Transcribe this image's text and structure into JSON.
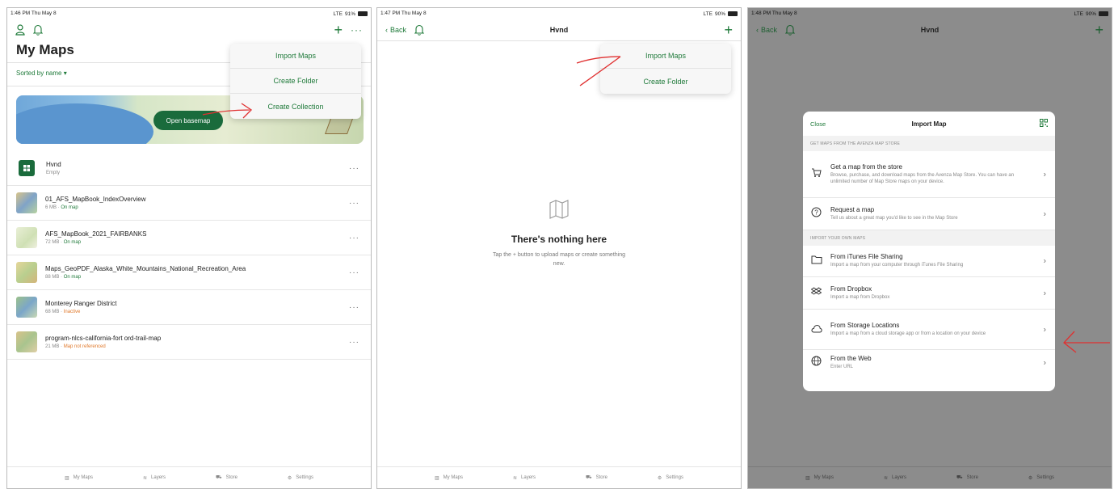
{
  "screen1": {
    "status": {
      "time": "1:46 PM  Thu May 8",
      "signal": "LTE",
      "battery": "91%"
    },
    "title": "My Maps",
    "sort_label": "Sorted by name",
    "basemap_button": "Open basemap",
    "menu": [
      "Import Maps",
      "Create Folder",
      "Create Collection"
    ],
    "items": [
      {
        "name": "Hvnd",
        "size": "Empty",
        "status": ""
      },
      {
        "name": "01_AFS_MapBook_IndexOverview",
        "size": "6 MB",
        "status": "On map"
      },
      {
        "name": "AFS_MapBook_2021_FAIRBANKS",
        "size": "72 MB",
        "status": "On map"
      },
      {
        "name": "Maps_GeoPDF_Alaska_White_Mountains_National_Recreation_Area",
        "size": "88 MB",
        "status": "On map"
      },
      {
        "name": "Monterey Ranger District",
        "size": "68 MB",
        "status": "Inactive"
      },
      {
        "name": "program-nlcs-california-fort ord-trail-map",
        "size": "21 MB",
        "status": "Map not referenced"
      }
    ]
  },
  "screen2": {
    "status": {
      "time": "1:47 PM  Thu May 8",
      "signal": "LTE",
      "battery": "90%"
    },
    "back": "Back",
    "title": "Hvnd",
    "menu": [
      "Import Maps",
      "Create Folder"
    ],
    "empty_title": "There's nothing here",
    "empty_sub": "Tap the + button to upload maps or create something new."
  },
  "screen3": {
    "status": {
      "time": "1:48 PM  Thu May 8",
      "signal": "LTE",
      "battery": "90%"
    },
    "back": "Back",
    "title": "Hvnd",
    "modal": {
      "close": "Close",
      "title": "Import Map",
      "section1": "GET MAPS FROM THE AVENZA MAP STORE",
      "section2": "IMPORT YOUR OWN MAPS",
      "store": {
        "title": "Get a map from the store",
        "sub": "Browse, purchase, and download maps from the Avenza Map Store. You can have an unlimited number of Map Store maps on your device."
      },
      "request": {
        "title": "Request a map",
        "sub": "Tell us about a great map you'd like to see in the Map Store"
      },
      "itunes": {
        "title": "From iTunes File Sharing",
        "sub": "Import a map from your computer through iTunes File Sharing"
      },
      "dropbox": {
        "title": "From Dropbox",
        "sub": "Import a map from Dropbox"
      },
      "storage": {
        "title": "From Storage Locations",
        "sub": "Import a map from a cloud storage app or from a location on your device"
      },
      "web": {
        "title": "From the Web",
        "sub": "Enter URL"
      }
    }
  },
  "tabs": [
    "My Maps",
    "Layers",
    "Store",
    "Settings"
  ],
  "colors": {
    "accent": "#1f7a3a",
    "warn": "#e0782a",
    "annotation": "#e03030"
  }
}
